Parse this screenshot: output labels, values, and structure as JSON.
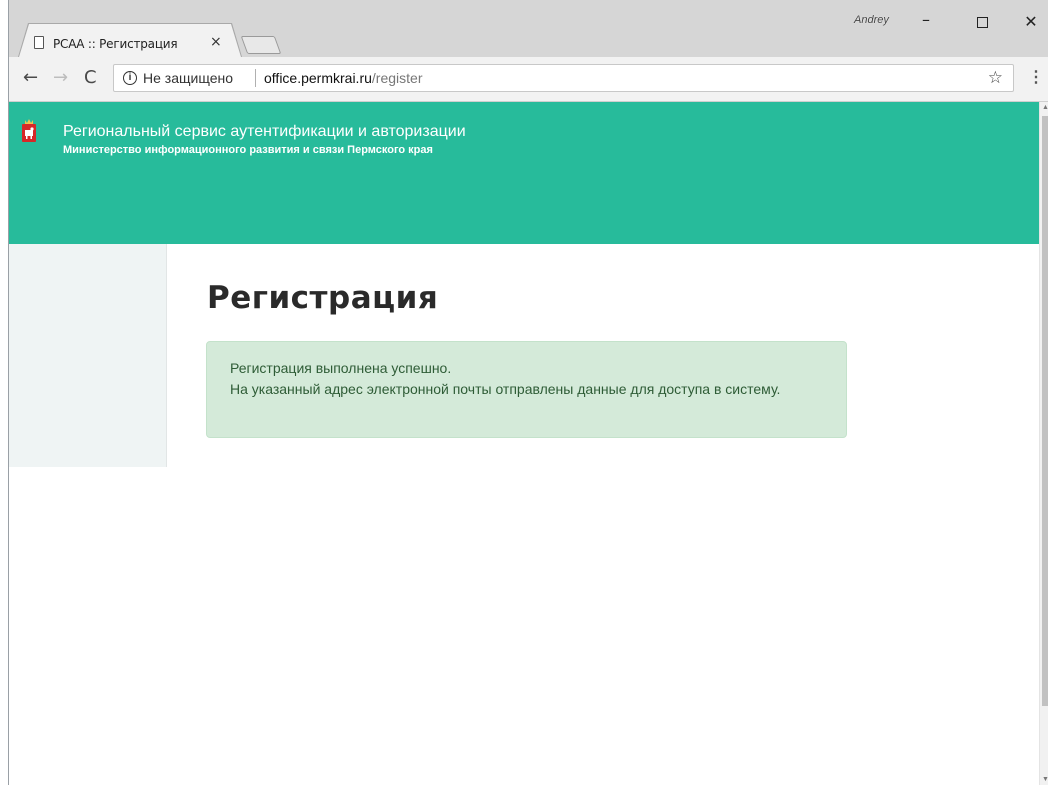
{
  "browser": {
    "tab_title": "РСАА :: Регистрация",
    "tab_close": "×",
    "profile_name": "Andrey",
    "window_controls": {
      "minimize": "–",
      "close": "✕"
    },
    "nav": {
      "back": "←",
      "forward": "→",
      "reload": "C"
    },
    "address": {
      "security_label": "Не защищено",
      "host": "office.permkrai.ru",
      "path": "/register"
    },
    "bookmark_icon": "☆",
    "menu_icon": "⋮"
  },
  "site": {
    "title": "Региональный сервис аутентификации и авторизации",
    "subtitle": "Министерство информационного развития и связи Пермского края",
    "brand_color": "#27bb9b"
  },
  "main": {
    "page_title": "Регистрация",
    "alert": {
      "line1": "Регистрация выполнена успешно.",
      "line2": "На указанный адрес электронной почты отправлены данные для доступа в систему."
    }
  },
  "icons": {
    "tab_icon": "page-icon",
    "info_icon": "info-icon",
    "crest_icon": "perm-krai-crest-icon"
  }
}
